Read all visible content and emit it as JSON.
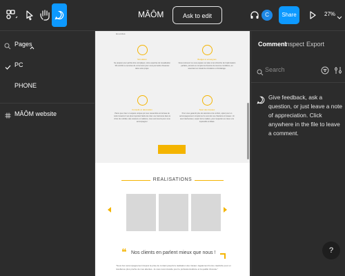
{
  "topbar": {
    "doc_title": "MÂÔM",
    "ask_to_edit": "Ask to edit",
    "avatar_initial": "C",
    "share": "Share",
    "zoom": "27%"
  },
  "pages": {
    "title": "Pages",
    "items": [
      "PC",
      "PHONE"
    ],
    "frame": "MÂÔM website"
  },
  "canvas": {
    "top_fragment": "les envies.",
    "features": [
      {
        "title": "Simulation",
        "text": "Se projeter pour parfois être compliqué, notre expertise de visualisation 3D enrichit ou services de vol ennemi pour vous permettre d'avancer dans votre projet."
      },
      {
        "title": "Budget et enseignes",
        "text": "Nous retrouvez ce vous espace sur plan à la recherche de l'optimisation parfaite, prenant en compte les besoins de tous les conditions, en associant un travail de circulation et d'éclairage."
      },
      {
        "title": "Conseils et décoration",
        "text": "Parce que créer un espace unique qui vous ressemble est la base de notre travail et il est plus important facile de créer une harmonie dans le choix du mobilier, des couleurs et matières, nous sommes là pour vous accompagner."
      },
      {
        "title": "Suivi des travaux",
        "text": "Pour vous garantir plus de sérénité et de confort, optez pour un accompagnement complet sur le suivi de vos chantiers et travaux. Un seul interlocuteur, expert de la matière, pour respecter au mieux vos impératifs et délais."
      }
    ],
    "realisations": "REALISATIONS",
    "testimonials_heading": "Nos clients en parlent mieux que nous !",
    "testimonial_text": "\"Nous bon accompagnement depuis la prise de contact jusqu'à la réalisation des travaux. Egalement bonne réactivité pour un résultat au plus proche de mes attentes. Je vous recommande pour le professionnalisme et la qualité d'écoute.\""
  },
  "right_panel": {
    "tabs": [
      "Comment",
      "Inspect",
      "Export"
    ],
    "search_placeholder": "Search",
    "feedback": "Give feedback, ask a question, or just leave a note of appreciation. Click anywhere in the file to leave a comment.",
    "help": "?"
  },
  "colors": {
    "accent": "#0d99ff",
    "brand_yellow": "#f4b400",
    "panel_bg": "#2c2c2c"
  }
}
